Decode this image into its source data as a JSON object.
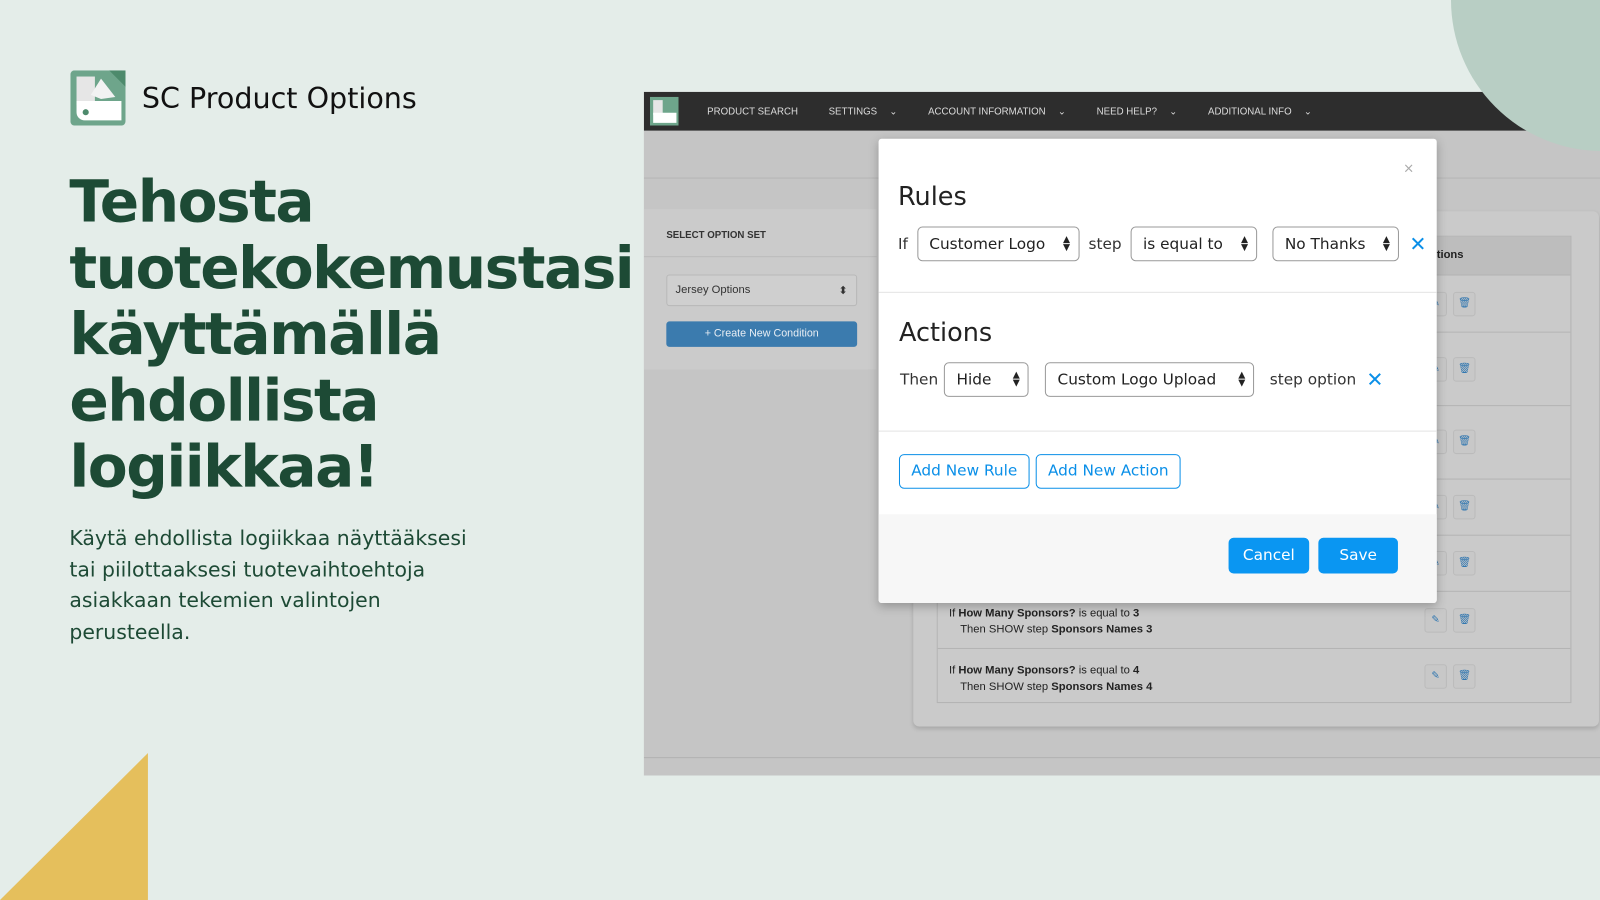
{
  "brand": {
    "name": "SC Product Options"
  },
  "headline": "Tehosta tuotekokemustasi käyttämällä ehdollista logiikkaa!",
  "description": "Käytä ehdollista logiikkaa näyttääksesi tai piilottaaksesi tuotevaihtoehtoja asiakkaan tekemien valintojen perusteella.",
  "colors": {
    "background": "#e4ede9",
    "heading": "#1d4a35",
    "accent_yellow": "#e5bf5c",
    "accent_blue": "#0a96f2"
  },
  "app": {
    "nav": [
      {
        "label": "PRODUCT SEARCH",
        "dropdown": false
      },
      {
        "label": "SETTINGS",
        "dropdown": true
      },
      {
        "label": "ACCOUNT INFORMATION",
        "dropdown": true
      },
      {
        "label": "NEED HELP?",
        "dropdown": true
      },
      {
        "label": "ADDITIONAL INFO",
        "dropdown": true
      }
    ],
    "left_panel": {
      "label": "SELECT OPTION SET",
      "select_value": "Jersey Options",
      "create_button": "+ Create New Condition"
    },
    "table": {
      "header_actions": "tions",
      "rows": [
        {
          "if_label": "If",
          "field": "How Many Sponsors?",
          "op": "is equal to",
          "value": "3",
          "then": "Then SHOW step",
          "target": "Sponsors Names 3"
        },
        {
          "if_label": "If",
          "field": "How Many Sponsors?",
          "op": "is equal to",
          "value": "4",
          "then": "Then SHOW step",
          "target": "Sponsors Names 4"
        }
      ]
    }
  },
  "modal": {
    "close": "×",
    "rules_title": "Rules",
    "if_label": "If",
    "field": "Customer Logo",
    "step_label": "step",
    "operator": "is equal to",
    "value": "No Thanks",
    "actions_title": "Actions",
    "then_label": "Then",
    "action": "Hide",
    "target": "Custom Logo Upload",
    "step_option_label": "step option",
    "add_rule": "Add New Rule",
    "add_action": "Add New Action",
    "cancel": "Cancel",
    "save": "Save"
  }
}
